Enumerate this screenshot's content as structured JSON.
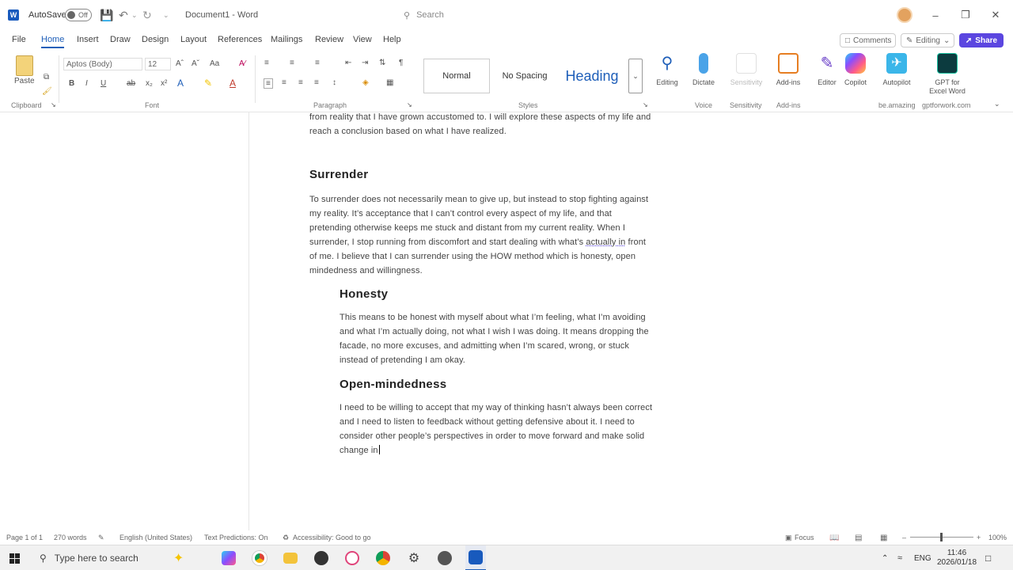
{
  "titlebar": {
    "autosave_label": "AutoSave",
    "autosave_state": "Off",
    "document_title": "Document1 - Word",
    "search_placeholder": "Search"
  },
  "tabs": [
    "File",
    "Home",
    "Insert",
    "Draw",
    "Design",
    "Layout",
    "References",
    "Mailings",
    "Review",
    "View",
    "Help"
  ],
  "active_tab": "Home",
  "top_actions": {
    "comments": "Comments",
    "editing": "Editing",
    "share": "Share"
  },
  "ribbon": {
    "paste_label": "Paste",
    "font_name": "Aptos (Body)",
    "font_size": "12",
    "styles": {
      "normal": "Normal",
      "no_spacing": "No Spacing",
      "heading": "Heading"
    },
    "buttons": {
      "editing": "Editing",
      "dictate": "Dictate",
      "sensitivity": "Sensitivity",
      "addins": "Add-ins",
      "editor": "Editor",
      "copilot": "Copilot",
      "autopilot": "Autopilot",
      "gpt_line1": "GPT for",
      "gpt_line2": "Excel Word"
    },
    "groups": {
      "clipboard": "Clipboard",
      "font": "Font",
      "paragraph": "Paragraph",
      "styles": "Styles",
      "voice": "Voice",
      "sensitivity": "Sensitivity",
      "addins": "Add-ins",
      "be_amazing": "be.amazing",
      "gptforwork": "gptforwork.com"
    },
    "accent_colors": {
      "brand": "#5b46e0",
      "tab_active": "#1f5fb9",
      "heading_style": "#1f5fb9"
    }
  },
  "document": {
    "intro_line1": "from reality that I have grown accustomed to. I will explore these aspects of my life and",
    "intro_line2": "reach a conclusion based on what I have realized.",
    "h_surrender": "Surrender",
    "surrender_p": {
      "line1": "To surrender does not necessarily mean to give up, but instead to stop fighting against",
      "line2": "my reality. It’s acceptance that I can’t control every aspect of my life, and that",
      "line3": "pretending otherwise keeps me stuck and distant from my current reality. When I",
      "line4_a": "surrender, I stop running from discomfort and start dealing with what’s ",
      "line4_b": "actually in",
      "line4_c": " front",
      "line5": "of me. I believe that I can surrender using the HOW method which is honesty, open",
      "line6": "mindedness and willingness."
    },
    "h_honesty": "Honesty",
    "honesty_p": {
      "line1": "This means to be honest with myself about what I’m feeling, what I’m avoiding",
      "line2": "and what I’m actually doing, not what I wish I was doing. It means dropping the",
      "line3": "facade, no more excuses, and admitting when I’m scared, wrong, or stuck",
      "line4": "instead of pretending I am okay."
    },
    "h_open": "Open-mindedness",
    "open_p": {
      "line1": "I need to be willing to accept that my way of thinking hasn’t always been correct",
      "line2": "and I need to listen to feedback without getting defensive about it. I need to",
      "line3": "consider other people’s perspectives in order to move forward and make solid",
      "line4": "change in"
    }
  },
  "statusbar": {
    "page": "Page 1 of 1",
    "words": "270 words",
    "language": "English (United States)",
    "predictions": "Text Predictions: On",
    "accessibility": "Accessibility: Good to go",
    "focus": "Focus",
    "zoom": "100%"
  },
  "taskbar": {
    "search_placeholder": "Type here to search",
    "lang": "ENG",
    "time": "11:46",
    "date": "2026/01/18"
  }
}
